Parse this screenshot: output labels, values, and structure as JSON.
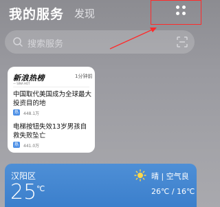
{
  "header": {
    "active_tab": "我的服务",
    "inactive_tab": "发现"
  },
  "search": {
    "placeholder": "搜索服务"
  },
  "news_card": {
    "brand": "新浪热榜",
    "brand_sub": "— SINA HOT",
    "time": "1分钟前",
    "items": [
      {
        "title": "中国取代美国成为全球最大投资目的地",
        "badge": "热",
        "count": "448.1万"
      },
      {
        "title": "电梯按钮失效13岁男孩自救失败坠亡",
        "badge": "热",
        "count": "441.0万"
      }
    ]
  },
  "weather": {
    "city": "汉阳区",
    "temp": "25",
    "unit": "℃",
    "condition": "晴 | 空气良",
    "range": "26℃ / 16℃"
  },
  "colors": {
    "annotation": "#ff2a2a",
    "weather_bg": "#3b7fcc",
    "badge": "#4a8ee6"
  }
}
